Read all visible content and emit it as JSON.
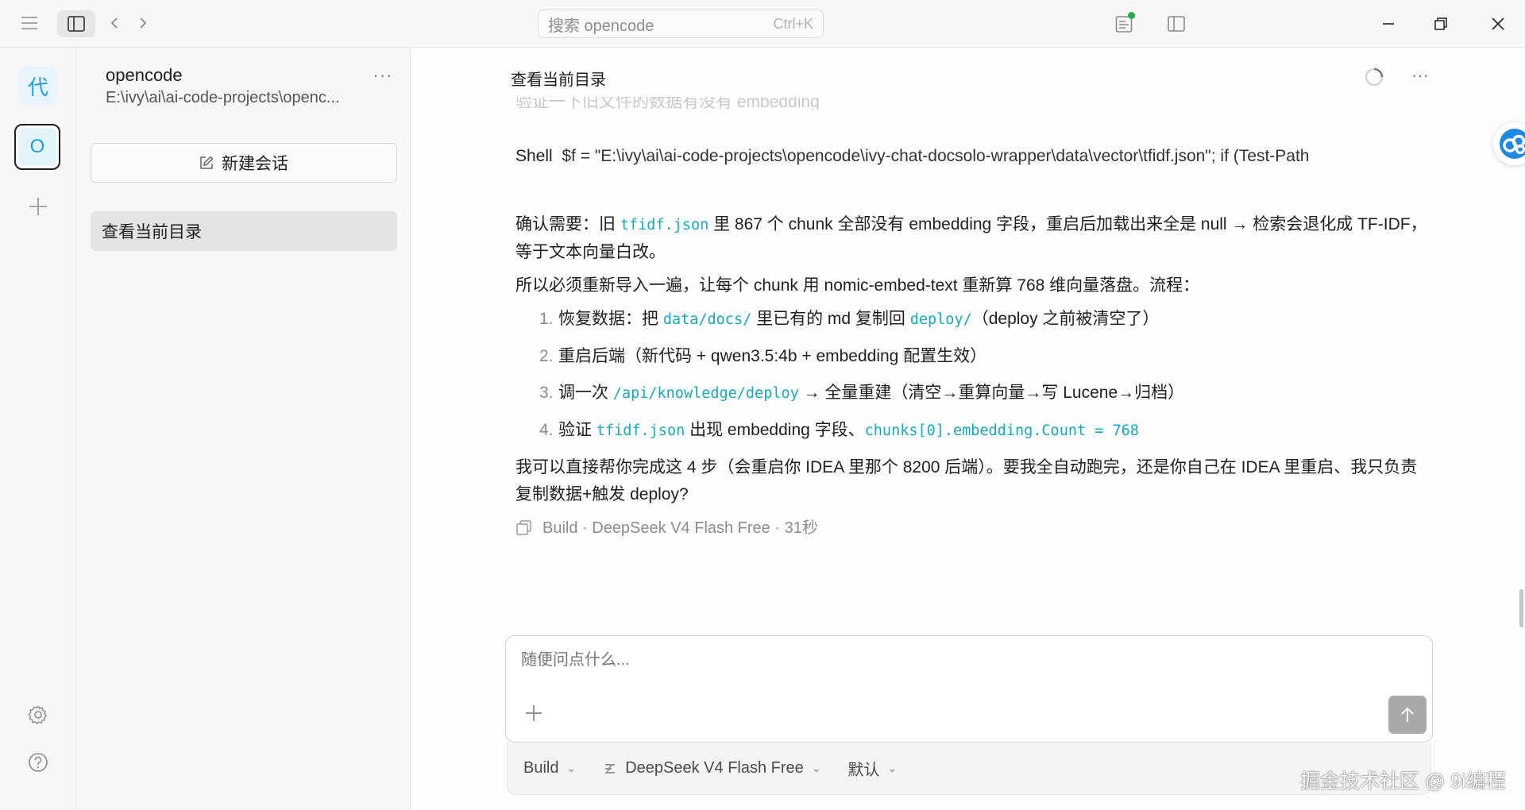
{
  "titlebar": {
    "search_placeholder": "搜索 opencode",
    "search_shortcut": "Ctrl+K"
  },
  "rail": {
    "projects": [
      {
        "initial": "代"
      },
      {
        "initial": "O"
      }
    ]
  },
  "sidebar": {
    "project_name": "opencode",
    "project_path": "E:\\ivy\\ai\\ai-code-projects\\openc...",
    "new_session_label": "新建会话",
    "sessions": [
      {
        "title": "查看当前目录"
      }
    ]
  },
  "chat": {
    "title": "查看当前目录",
    "faded_line": "验证一下旧文件的数据有没有 embedding",
    "shell": {
      "label": "Shell",
      "command": "$f = \"E:\\ivy\\ai\\ai-code-projects\\opencode\\ivy-chat-docsolo-wrapper\\data\\vector\\tfidf.json\"; if (Test-Path"
    },
    "para1": {
      "pre": "确认需要：旧 ",
      "code": "tfidf.json",
      "post": " 里 867 个 chunk 全部没有 embedding 字段，重启后加载出来全是 null → 检索会退化成 TF-IDF，等于文本向量白改。"
    },
    "para2": "所以必须重新导入一遍，让每个 chunk 用 nomic-embed-text 重新算 768 维向量落盘。流程：",
    "steps": [
      {
        "num": "1.",
        "pre": "恢复数据：把 ",
        "code": "data/docs/",
        "mid": " 里已有的 md 复制回 ",
        "code2": "deploy/",
        "post": "（deploy 之前被清空了）"
      },
      {
        "num": "2.",
        "pre": "重启后端（新代码 + qwen3.5:4b + embedding 配置生效）",
        "code": "",
        "mid": "",
        "code2": "",
        "post": ""
      },
      {
        "num": "3.",
        "pre": "调一次 ",
        "code": "/api/knowledge/deploy",
        "mid": " → 全量重建（清空→重算向量→写 Lucene→归档）",
        "code2": "",
        "post": ""
      },
      {
        "num": "4.",
        "pre": "验证 ",
        "code": "tfidf.json",
        "mid": " 出现 embedding 字段、",
        "code2": "chunks[0].embedding.Count = 768",
        "post": ""
      }
    ],
    "para3": "我可以直接帮你完成这 4 步（会重启你 IDEA 里那个 8200 后端）。要我全自动跑完，还是你自己在 IDEA 里重启、我只负责复制数据+触发 deploy?",
    "meta": "Build · DeepSeek V4 Flash Free · 31秒"
  },
  "composer": {
    "placeholder": "随便问点什么...",
    "agent": "Build",
    "model": "DeepSeek V4 Flash Free",
    "variant": "默认"
  },
  "watermark": "掘金技术社区 @ 9i编程",
  "colors": {
    "code": "#1aa9b6",
    "accent_blue": "#2a9fd6",
    "status_online": "#22b14c"
  }
}
